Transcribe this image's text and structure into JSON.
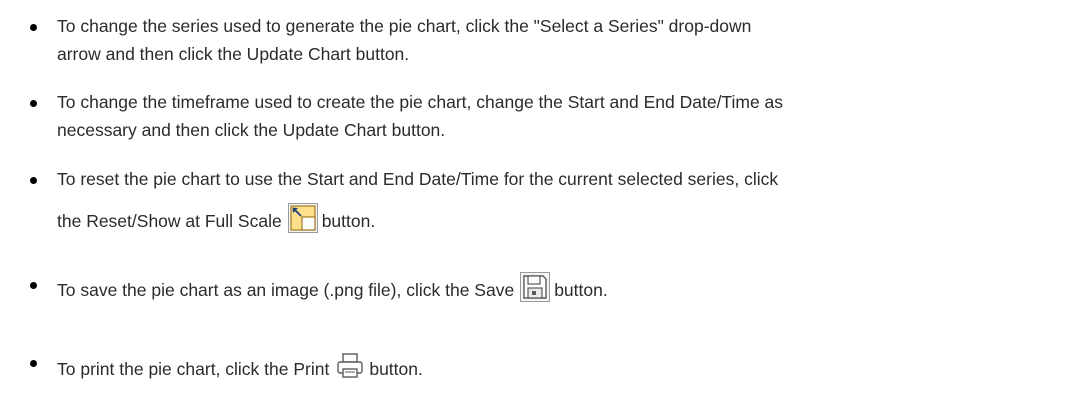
{
  "bullets": [
    {
      "lines": [
        "To change the series used to generate the pie chart, click the \"Select a Series\" drop-down",
        "arrow and then click the Update Chart button."
      ]
    },
    {
      "lines": [
        "To change the timeframe used to create the pie chart, change the Start and End Date/Time as",
        "necessary and then click the Update Chart button."
      ]
    },
    {
      "lines": [
        "To reset the pie chart to use the Start and End Date/Time for the current selected series, click"
      ],
      "before_icon": "the Reset/Show at Full Scale",
      "icon": "reset-full-scale-icon",
      "after_icon": "button."
    },
    {
      "before_icon": "To save the pie chart as an image (.png file), click the Save",
      "icon": "save-icon",
      "after_icon": "button."
    },
    {
      "before_icon": "To print the pie chart, click the Print",
      "icon": "print-icon",
      "after_icon": "button."
    }
  ]
}
